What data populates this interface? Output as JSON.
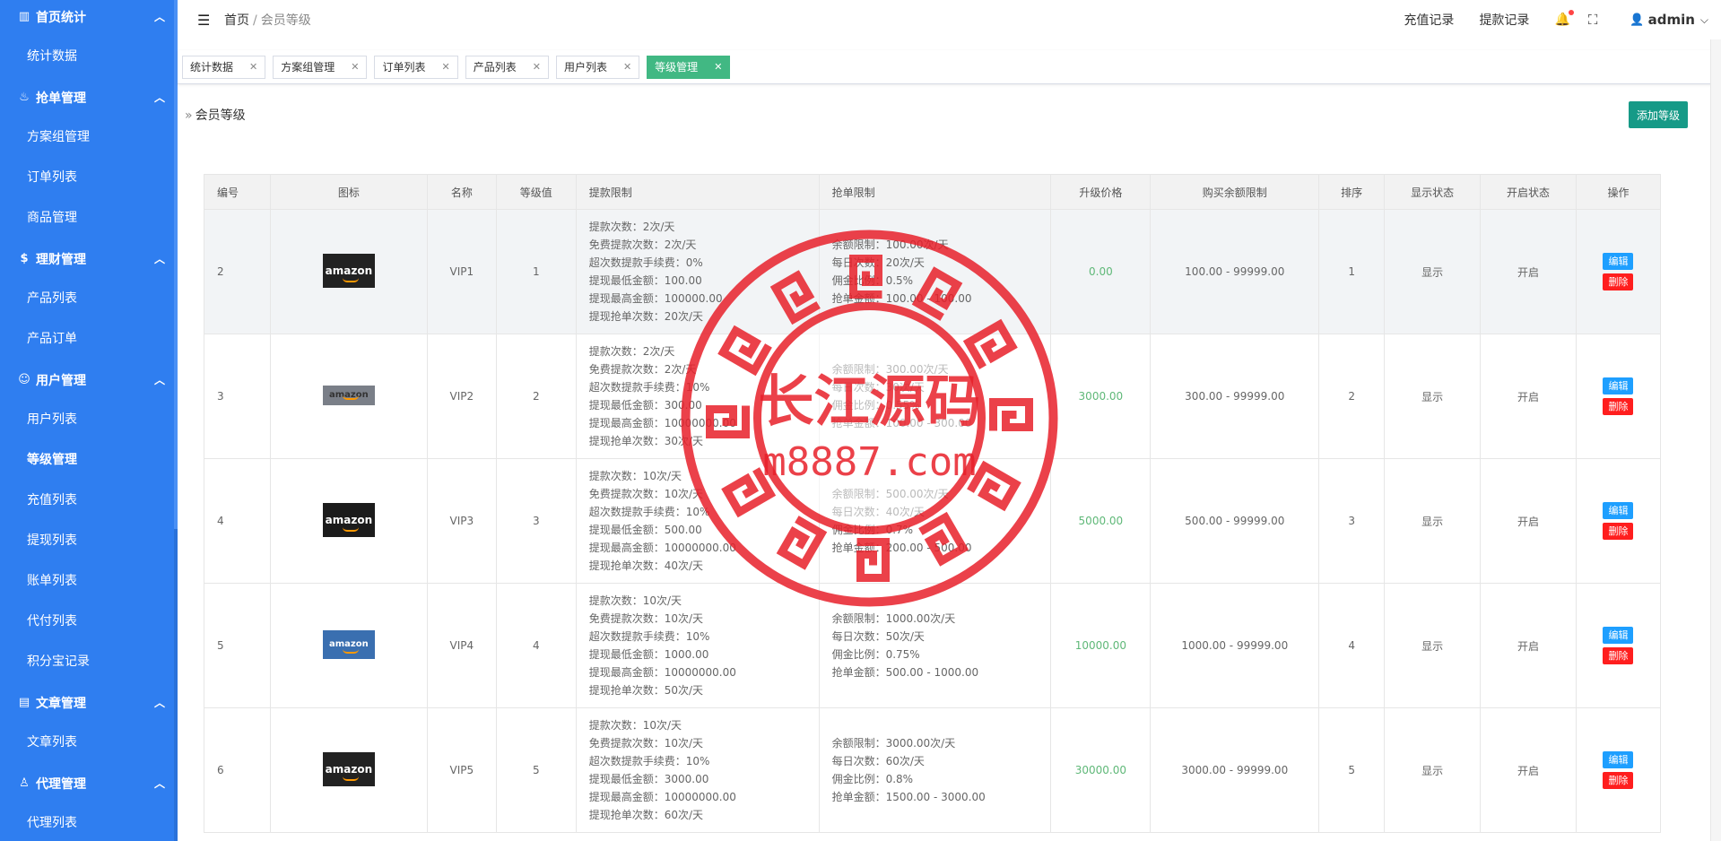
{
  "sidebar": {
    "groups": [
      {
        "label": "首页统计",
        "icon": "chart-icon",
        "items": [
          "统计数据"
        ]
      },
      {
        "label": "抢单管理",
        "icon": "fire-icon",
        "items": [
          "方案组管理",
          "订单列表",
          "商品管理"
        ]
      },
      {
        "label": "理财管理",
        "icon": "finance-icon",
        "items": [
          "产品列表",
          "产品订单"
        ]
      },
      {
        "label": "用户管理",
        "icon": "user-icon",
        "items": [
          "用户列表",
          "等级管理",
          "充值列表",
          "提现列表",
          "账单列表",
          "代付列表",
          "积分宝记录"
        ]
      },
      {
        "label": "文章管理",
        "icon": "document-icon",
        "items": [
          "文章列表"
        ]
      },
      {
        "label": "代理管理",
        "icon": "agent-icon",
        "items": [
          "代理列表"
        ]
      }
    ],
    "active_item": "等级管理"
  },
  "header": {
    "breadcrumb_home": "首页",
    "breadcrumb_sep": "/",
    "breadcrumb_current": "会员等级",
    "recharge_link": "充值记录",
    "withdraw_link": "提款记录",
    "username": "admin"
  },
  "tabs": [
    {
      "label": "统计数据",
      "active": false
    },
    {
      "label": "方案组管理",
      "active": false
    },
    {
      "label": "订单列表",
      "active": false
    },
    {
      "label": "产品列表",
      "active": false
    },
    {
      "label": "用户列表",
      "active": false
    },
    {
      "label": "等级管理",
      "active": true
    }
  ],
  "section": {
    "title": "会员等级",
    "add_button": "添加等级"
  },
  "table": {
    "columns": [
      "编号",
      "图标",
      "名称",
      "等级值",
      "提款限制",
      "抢单限制",
      "升级价格",
      "购买余额限制",
      "排序",
      "显示状态",
      "开启状态",
      "操作"
    ],
    "edit_label": "编辑",
    "delete_label": "删除",
    "rows": [
      {
        "id": "2",
        "icon_text": "amazon",
        "name": "VIP1",
        "level": "1",
        "withdraw": [
          "提款次数：2次/天",
          "免费提款次数：2次/天",
          "超次数提款手续费：0%",
          "提现最低金额：100.00",
          "提现最高金额：100000.00",
          "提现抢单次数：20次/天"
        ],
        "grab": [
          "余额限制：100.00次/天",
          "每日次数：20次/天",
          "佣金比例：0.5%",
          "抢单金额：100.00 - 100.00"
        ],
        "price": "0.00",
        "balance": "100.00 - 99999.00",
        "sort": "1",
        "show": "显示",
        "open": "开启"
      },
      {
        "id": "3",
        "icon_text": "amazon",
        "name": "VIP2",
        "level": "2",
        "withdraw": [
          "提款次数：2次/天",
          "免费提款次数：2次/天",
          "超次数提款手续费：10%",
          "提现最低金额：300.00",
          "提现最高金额：10000000.00",
          "提现抢单次数：30次/天"
        ],
        "grab": [
          "余额限制：300.00次/天",
          "每日次数：30次/天",
          "佣金比例：0.55%",
          "抢单金额：100.00 - 300.00"
        ],
        "price": "3000.00",
        "balance": "300.00 - 99999.00",
        "sort": "2",
        "show": "显示",
        "open": "开启"
      },
      {
        "id": "4",
        "icon_text": "amazon",
        "name": "VIP3",
        "level": "3",
        "withdraw": [
          "提款次数：10次/天",
          "免费提款次数：10次/天",
          "超次数提款手续费：10%",
          "提现最低金额：500.00",
          "提现最高金额：10000000.00",
          "提现抢单次数：40次/天"
        ],
        "grab": [
          "余额限制：500.00次/天",
          "每日次数：40次/天",
          "佣金比例：0.7%",
          "抢单金额：200.00 - 500.00"
        ],
        "price": "5000.00",
        "balance": "500.00 - 99999.00",
        "sort": "3",
        "show": "显示",
        "open": "开启"
      },
      {
        "id": "5",
        "icon_text": "amazon",
        "name": "VIP4",
        "level": "4",
        "withdraw": [
          "提款次数：10次/天",
          "免费提款次数：10次/天",
          "超次数提款手续费：10%",
          "提现最低金额：1000.00",
          "提现最高金额：10000000.00",
          "提现抢单次数：50次/天"
        ],
        "grab": [
          "余额限制：1000.00次/天",
          "每日次数：50次/天",
          "佣金比例：0.75%",
          "抢单金额：500.00 - 1000.00"
        ],
        "price": "10000.00",
        "balance": "1000.00 - 99999.00",
        "sort": "4",
        "show": "显示",
        "open": "开启"
      },
      {
        "id": "6",
        "icon_text": "amazon",
        "name": "VIP5",
        "level": "5",
        "withdraw": [
          "提款次数：10次/天",
          "免费提款次数：10次/天",
          "超次数提款手续费：10%",
          "提现最低金额：3000.00",
          "提现最高金额：10000000.00",
          "提现抢单次数：60次/天"
        ],
        "grab": [
          "余额限制：3000.00次/天",
          "每日次数：60次/天",
          "佣金比例：0.8%",
          "抢单金额：1500.00 - 3000.00"
        ],
        "price": "30000.00",
        "balance": "3000.00 - 99999.00",
        "sort": "5",
        "show": "显示",
        "open": "开启"
      }
    ]
  },
  "watermark": {
    "line1": "长江源码",
    "line2": "m8887.com"
  },
  "colors": {
    "sidebar": "#2f7ef0",
    "active_tab": "#41b883",
    "add_button": "#169a87",
    "edit": "#1e9fff",
    "delete": "#ff1e1e",
    "price": "#5fb878",
    "stamp": "#e8202a"
  }
}
